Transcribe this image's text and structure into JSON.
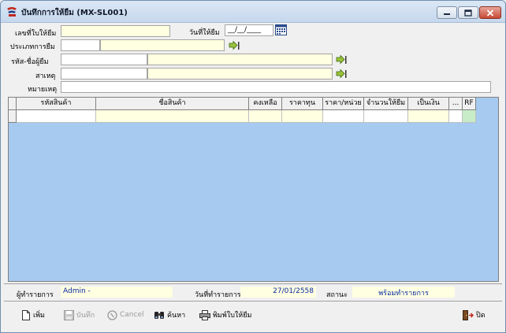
{
  "window": {
    "title": "บันทึกการให้ยืม (MX-SL001)"
  },
  "form": {
    "doc_no_label": "เลขที่ใบให้ยืม",
    "doc_no_value": "",
    "date_label": "วันที่ให้ยืม",
    "date_value": "__/__/____",
    "type_label": "ประเภทการยืม",
    "type_code": "",
    "type_name": "",
    "borrower_label": "รหัส-ชื่อผู้ยืม",
    "borrower_code": "",
    "borrower_name": "",
    "reason_label": "สาเหตุ",
    "reason_code": "",
    "reason_name": "",
    "remark_label": "หมายเหตุ",
    "remark_value": ""
  },
  "grid": {
    "columns": [
      "รหัสสินค้า",
      "ชื่อสินค้า",
      "คงเหลือ",
      "ราคาทุน",
      "ราคา/หน่วย",
      "จำนวนให้ยืม",
      "เป็นเงิน",
      "...",
      "RF"
    ],
    "rows": [
      [
        "",
        "",
        "",
        "",
        "",
        "",
        "",
        "",
        ""
      ]
    ]
  },
  "status": {
    "user_label": "ผู้ทำรายการ",
    "user_value": "Admin -",
    "txn_date_label": "วันที่ทำรายการ",
    "txn_date_value": "27/01/2558",
    "state_label": "สถานะ",
    "state_value": "พร้อมทำรายการ"
  },
  "toolbar": {
    "add": "เพิ่ม",
    "save": "บันทึก",
    "cancel": "Cancel",
    "search": "ค้นหา",
    "print": "พิมพ์ใบให้ยืม",
    "close": "ปิด"
  },
  "colors": {
    "grid_background": "#a6caf0",
    "input_background": "#ffffe1",
    "status_text": "#0a2aa0"
  },
  "icons": [
    "app-logo-icon",
    "minimize-icon",
    "maximize-icon",
    "close-window-icon",
    "calendar-icon",
    "lookup-arrow-icon",
    "new-document-icon",
    "floppy-disk-icon",
    "cancel-circle-icon",
    "binoculars-icon",
    "printer-icon",
    "exit-door-icon"
  ]
}
